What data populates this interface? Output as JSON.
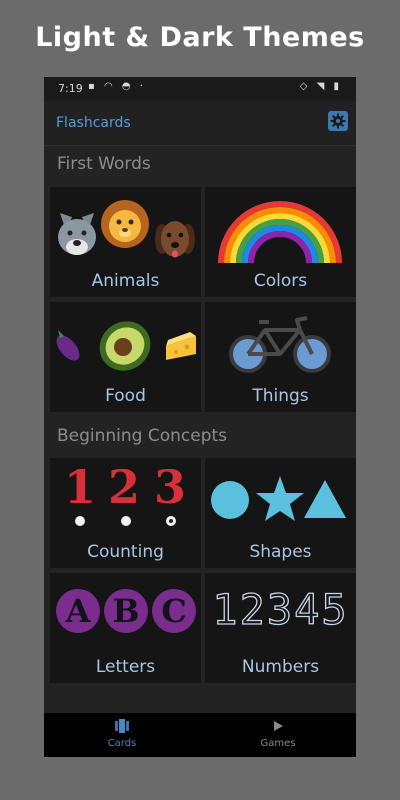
{
  "headline": "Light & Dark Themes",
  "status_bar": {
    "time": "7:19"
  },
  "app_bar": {
    "title": "Flashcards",
    "settings_icon": "gear-icon"
  },
  "sections": [
    {
      "title": "First Words"
    },
    {
      "title": "Beginning Concepts"
    }
  ],
  "cards": {
    "animals": {
      "label": "Animals",
      "icons": [
        "wolf",
        "lion",
        "dog"
      ]
    },
    "colors": {
      "label": "Colors",
      "icons": [
        "rainbow"
      ]
    },
    "food": {
      "label": "Food",
      "icons": [
        "eggplant",
        "avocado",
        "cheese"
      ]
    },
    "things": {
      "label": "Things",
      "icons": [
        "bicycle"
      ]
    },
    "counting": {
      "label": "Counting",
      "digits": [
        "1",
        "2",
        "3"
      ]
    },
    "shapes": {
      "label": "Shapes",
      "icons": [
        "circle",
        "star",
        "triangle"
      ]
    },
    "letters": {
      "label": "Letters",
      "letters": [
        "A",
        "B",
        "C"
      ]
    },
    "numbers": {
      "label": "Numbers",
      "digits": "12345"
    }
  },
  "bottom_nav": {
    "items": [
      {
        "label": "Cards",
        "icon": "cards-icon"
      },
      {
        "label": "Games",
        "icon": "play-icon"
      }
    ]
  },
  "colors": {
    "accent": "#5b9bd5",
    "background": "#232323",
    "tile": "#151515",
    "tile_label": "#a9c6e3",
    "section_title": "#8d8d8d"
  }
}
